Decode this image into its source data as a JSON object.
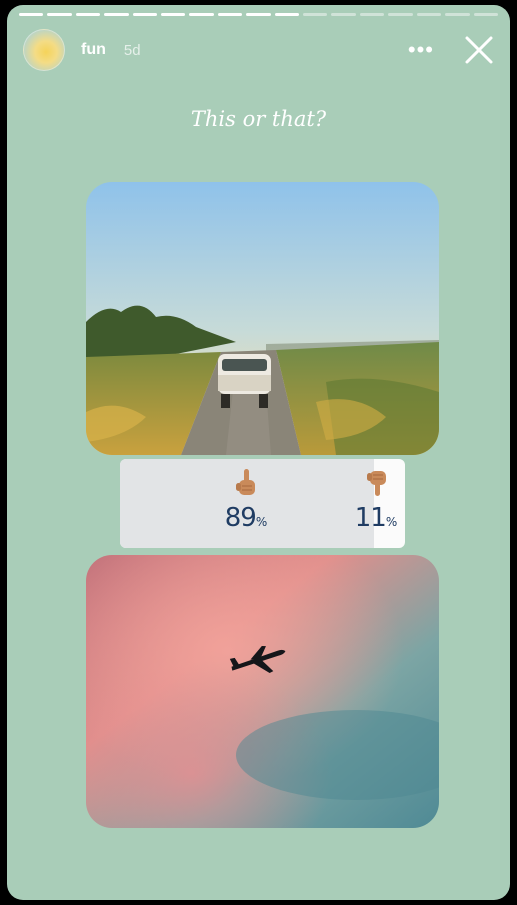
{
  "story": {
    "username": "fun",
    "time": "5d",
    "more_label": "•••",
    "background": "#a9cdb8",
    "progress_segments": 17,
    "progress_completed": 10
  },
  "question": "This or that?",
  "poll": {
    "options": [
      {
        "emoji": "pointing-up-hand-icon",
        "value": "89",
        "unit": "%"
      },
      {
        "emoji": "thumbs-down-hand-icon",
        "value": "11",
        "unit": "%"
      }
    ],
    "result_fraction": 0.89
  },
  "photos": {
    "top": "vintage van on country road at sunset",
    "bottom": "airplane silhouette in pink sky"
  },
  "colors": {
    "percent_text": "#1f3c63",
    "poll_fill": "#e2e4e6"
  }
}
